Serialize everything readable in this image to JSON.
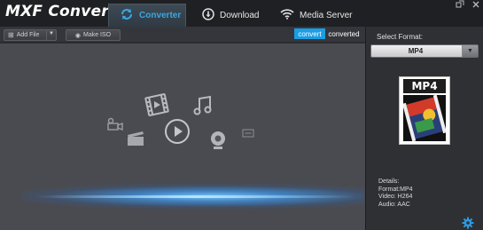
{
  "app": {
    "title": "MXF Converter"
  },
  "tabs": [
    {
      "label": "Converter",
      "icon": "refresh-icon",
      "active": true
    },
    {
      "label": "Download",
      "icon": "download-icon",
      "active": false
    },
    {
      "label": "Media Server",
      "icon": "wifi-icon",
      "active": false
    }
  ],
  "toolbar": {
    "add_file": "Add File",
    "make_iso": "Make ISO",
    "convert": "convert",
    "converted": "converted"
  },
  "side": {
    "select_label": "Select Format:",
    "format_value": "MP4",
    "thumb_label": "MP4",
    "details": {
      "heading": "Details:",
      "format": "Format:MP4",
      "video": "Video: H264",
      "audio": "Audio: AAC"
    }
  },
  "colors": {
    "accent": "#1b9de3",
    "titlebar": "#1f2023",
    "main_bg": "#4a4b50",
    "side_bg": "#2f3034"
  }
}
